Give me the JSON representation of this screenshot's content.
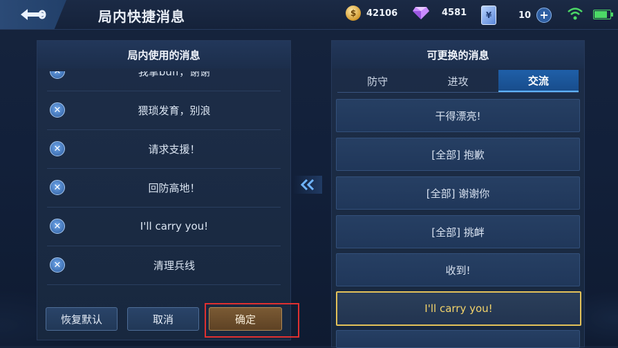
{
  "topbar": {
    "title": "局内快捷消息",
    "gold": "42106",
    "diamond": "4581",
    "coupon": "10",
    "coupon_symbol": "¥",
    "gold_symbol": "$"
  },
  "left": {
    "heading": "局内使用的消息",
    "messages": [
      "我拿buff，谢谢",
      "猥琐发育，别浪",
      "请求支援！",
      "回防高地！",
      "I'll carry you!",
      "清理兵线"
    ],
    "buttons": {
      "reset": "恢复默认",
      "cancel": "取消",
      "confirm": "确定"
    }
  },
  "right": {
    "heading": "可更换的消息",
    "tabs": [
      "防守",
      "进攻",
      "交流"
    ],
    "active_tab": "交流",
    "options": [
      "干得漂亮!",
      "[全部] 抱歉",
      "[全部] 谢谢你",
      "[全部] 挑衅",
      "收到!",
      "I'll carry you!"
    ],
    "selected_option": "I'll carry you!"
  },
  "icons": {
    "back": "back-arrow-icon",
    "remove": "close-icon",
    "swap": "double-chevron-left-icon",
    "wifi": "wifi-icon",
    "battery": "battery-icon"
  },
  "colors": {
    "accent_blue": "#1f5fa8",
    "selected_gold": "#e4c259",
    "confirm_brown": "#6b4c2b",
    "highlight_red": "#e03030",
    "signal_green": "#4cd966"
  }
}
